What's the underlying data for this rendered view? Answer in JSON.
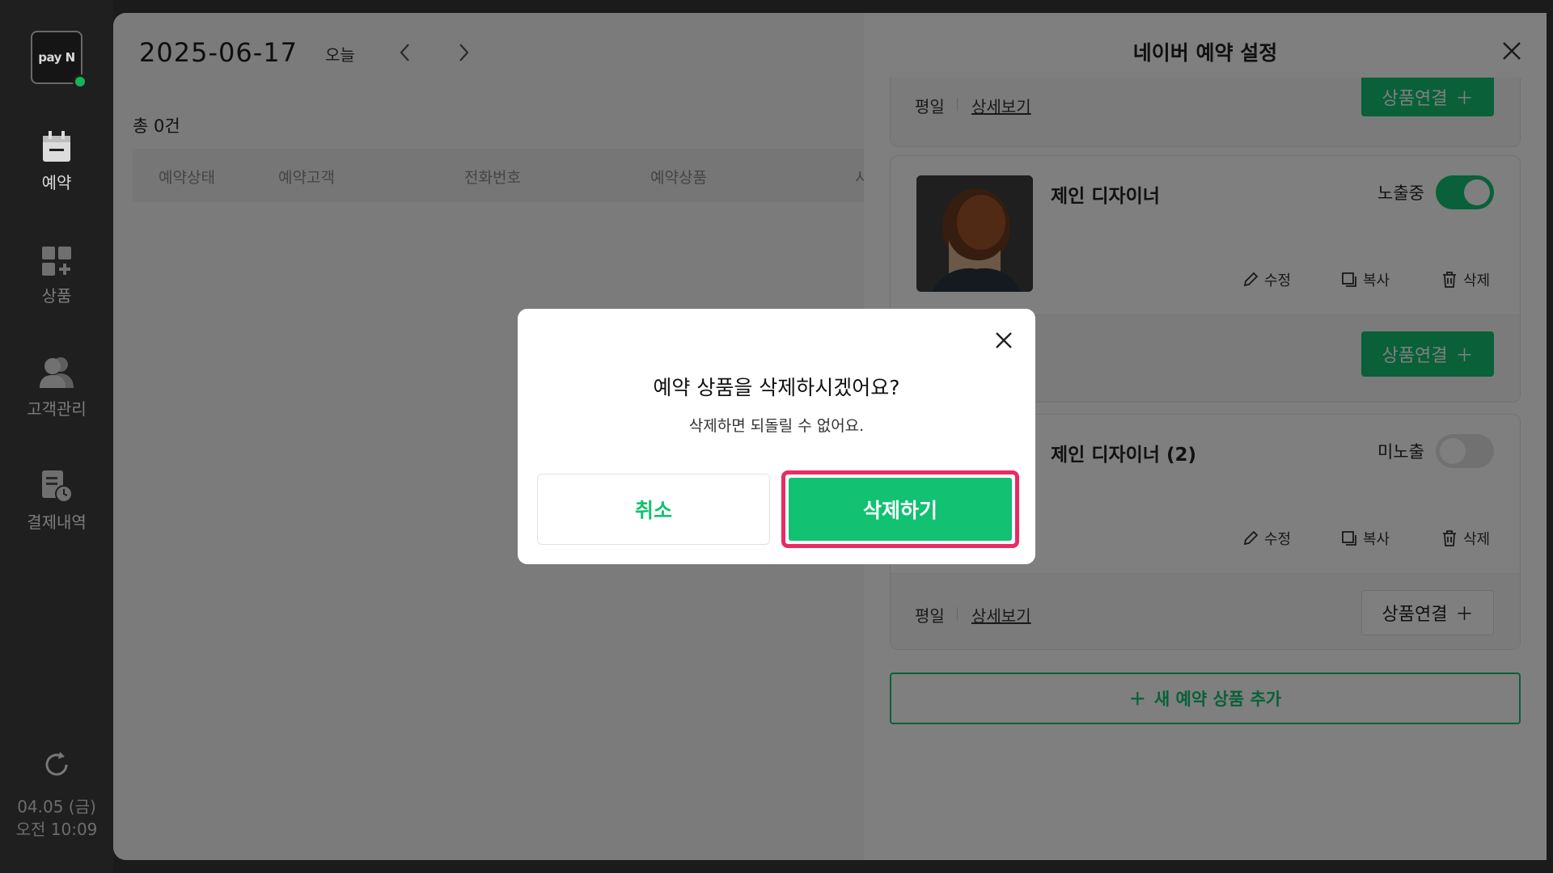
{
  "sidebar": {
    "logo_text": "pay N",
    "items": [
      {
        "label": "예약",
        "icon": "calendar-icon"
      },
      {
        "label": "상품",
        "icon": "product-grid-icon"
      },
      {
        "label": "고객관리",
        "icon": "customers-icon"
      },
      {
        "label": "결제내역",
        "icon": "payment-history-icon"
      }
    ],
    "refresh_icon": "refresh-icon",
    "date": "04.05 (금)",
    "time": "오전 10:09"
  },
  "calendar": {
    "date": "2025-06-17",
    "today_label": "오늘",
    "total": "총 0건",
    "columns": [
      "예약상태",
      "예약고객",
      "전화번호",
      "예약상품",
      "시"
    ]
  },
  "panel": {
    "title": "네이버 예약 설정",
    "cards": [
      {
        "foot_label": "평일",
        "detail_link": "상세보기",
        "link_button": "상품연결"
      },
      {
        "title": "제인 디자이너",
        "visibility": "노출중",
        "toggle_on": true,
        "edit": "수정",
        "copy": "복사",
        "delete": "삭제",
        "link_button": "상품연결"
      },
      {
        "title": "제인 디자이너 (2)",
        "visibility": "미노출",
        "toggle_on": false,
        "edit": "수정",
        "copy": "복사",
        "delete": "삭제",
        "foot_label": "평일",
        "detail_link": "상세보기",
        "link_button": "상품연결"
      }
    ],
    "add_new": "새 예약 상품 추가"
  },
  "modal": {
    "title": "예약 상품을 삭제하시겠어요?",
    "subtitle": "삭제하면 되돌릴 수 없어요.",
    "cancel": "취소",
    "confirm": "삭제하기"
  },
  "colors": {
    "accent": "#12c172",
    "highlight": "#ea2a63",
    "sidebar": "#1f1f1f"
  }
}
